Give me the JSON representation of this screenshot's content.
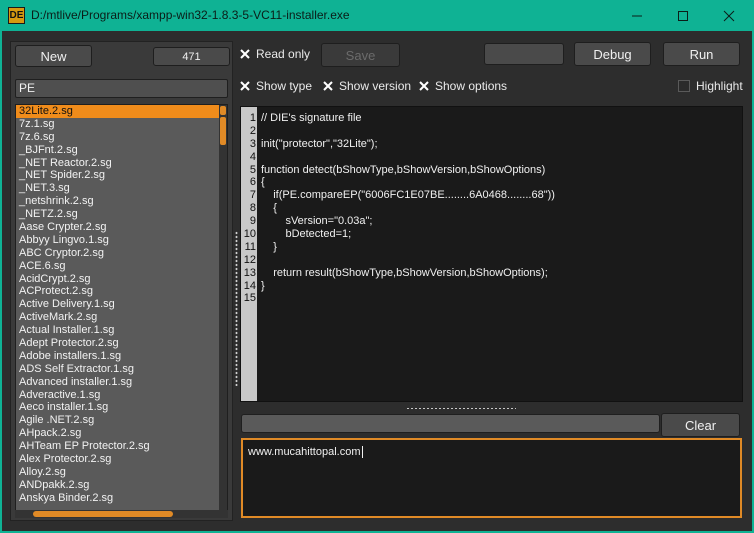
{
  "window": {
    "icon_text": "DE",
    "title": "D:/mtlive/Programs/xampp-win32-1.8.3-5-VC11-installer.exe"
  },
  "left": {
    "new_label": "New",
    "count": "471",
    "filter_value": "PE",
    "items": [
      "32Lite.2.sg",
      "7z.1.sg",
      "7z.6.sg",
      "_BJFnt.2.sg",
      "_NET Reactor.2.sg",
      "_NET Spider.2.sg",
      "_NET.3.sg",
      "_netshrink.2.sg",
      "_NETZ.2.sg",
      "Aase Crypter.2.sg",
      "Abbyy Lingvo.1.sg",
      "ABC Cryptor.2.sg",
      "ACE.6.sg",
      "AcidCrypt.2.sg",
      "ACProtect.2.sg",
      "Active Delivery.1.sg",
      "ActiveMark.2.sg",
      "Actual Installer.1.sg",
      "Adept Protector.2.sg",
      "Adobe installers.1.sg",
      "ADS Self Extractor.1.sg",
      "Advanced installer.1.sg",
      "Adveractive.1.sg",
      "Aeco installer.1.sg",
      "Agile .NET.2.sg",
      "AHpack.2.sg",
      "AHTeam EP Protector.2.sg",
      "Alex Protector.2.sg",
      "Alloy.2.sg",
      "ANDpakk.2.sg",
      "Anskya Binder.2.sg"
    ]
  },
  "toolbar": {
    "read_only_label": "Read only",
    "save_label": "Save",
    "debug_label": "Debug",
    "run_label": "Run"
  },
  "options": {
    "show_type": "Show type",
    "show_version": "Show version",
    "show_options": "Show options",
    "highlight": "Highlight"
  },
  "editor": {
    "line_numbers": [
      "1",
      "2",
      "3",
      "4",
      "5",
      "6",
      "7",
      "8",
      "9",
      "10",
      "11",
      "12",
      "13",
      "14",
      "15"
    ],
    "lines": [
      "// DIE's signature file",
      "",
      "init(\"protector\",\"32Lite\");",
      "",
      "function detect(bShowType,bShowVersion,bShowOptions)",
      "{",
      "    if(PE.compareEP(\"6006FC1E07BE........6A0468........68\"))",
      "    {",
      "        sVersion=\"0.03a\";",
      "        bDetected=1;",
      "    }",
      "",
      "    return result(bShowType,bShowVersion,bShowOptions);",
      "}",
      ""
    ]
  },
  "bottom": {
    "clear_label": "Clear",
    "log_text": "www.mucahittopal.com"
  },
  "colors": {
    "title_bar": "#0fb294",
    "accent": "#e08a26",
    "selection": "#f08c1b"
  }
}
